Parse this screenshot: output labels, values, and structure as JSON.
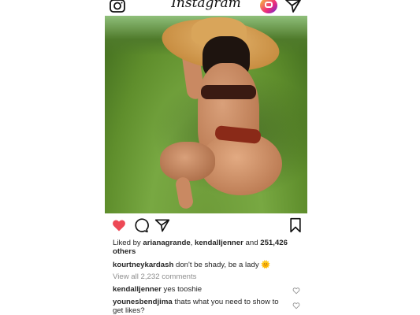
{
  "header": {
    "logo_text": "Instagram",
    "icons": [
      "camera-icon",
      "igtv-icon",
      "direct-send-icon"
    ]
  },
  "post": {
    "liked_by_prefix": "Liked by",
    "liked_user_1": "arianagrande",
    "liked_sep": ",",
    "liked_user_2": "kendalljenner",
    "liked_and": "and",
    "liked_count": "251,426",
    "liked_suffix": "others",
    "caption_user": "kourtneykardash",
    "caption_text": "don't be shady, be a lady",
    "caption_emoji": "🌞",
    "view_all": "View all 2,232 comments",
    "comments": [
      {
        "user": "kendalljenner",
        "text": "yes tooshie"
      },
      {
        "user": "younesbendjima",
        "text": "thats what you need to show to get likes?"
      }
    ]
  },
  "colors": {
    "like": "#ed4956",
    "text": "#262626",
    "muted": "#8e8e8e"
  }
}
